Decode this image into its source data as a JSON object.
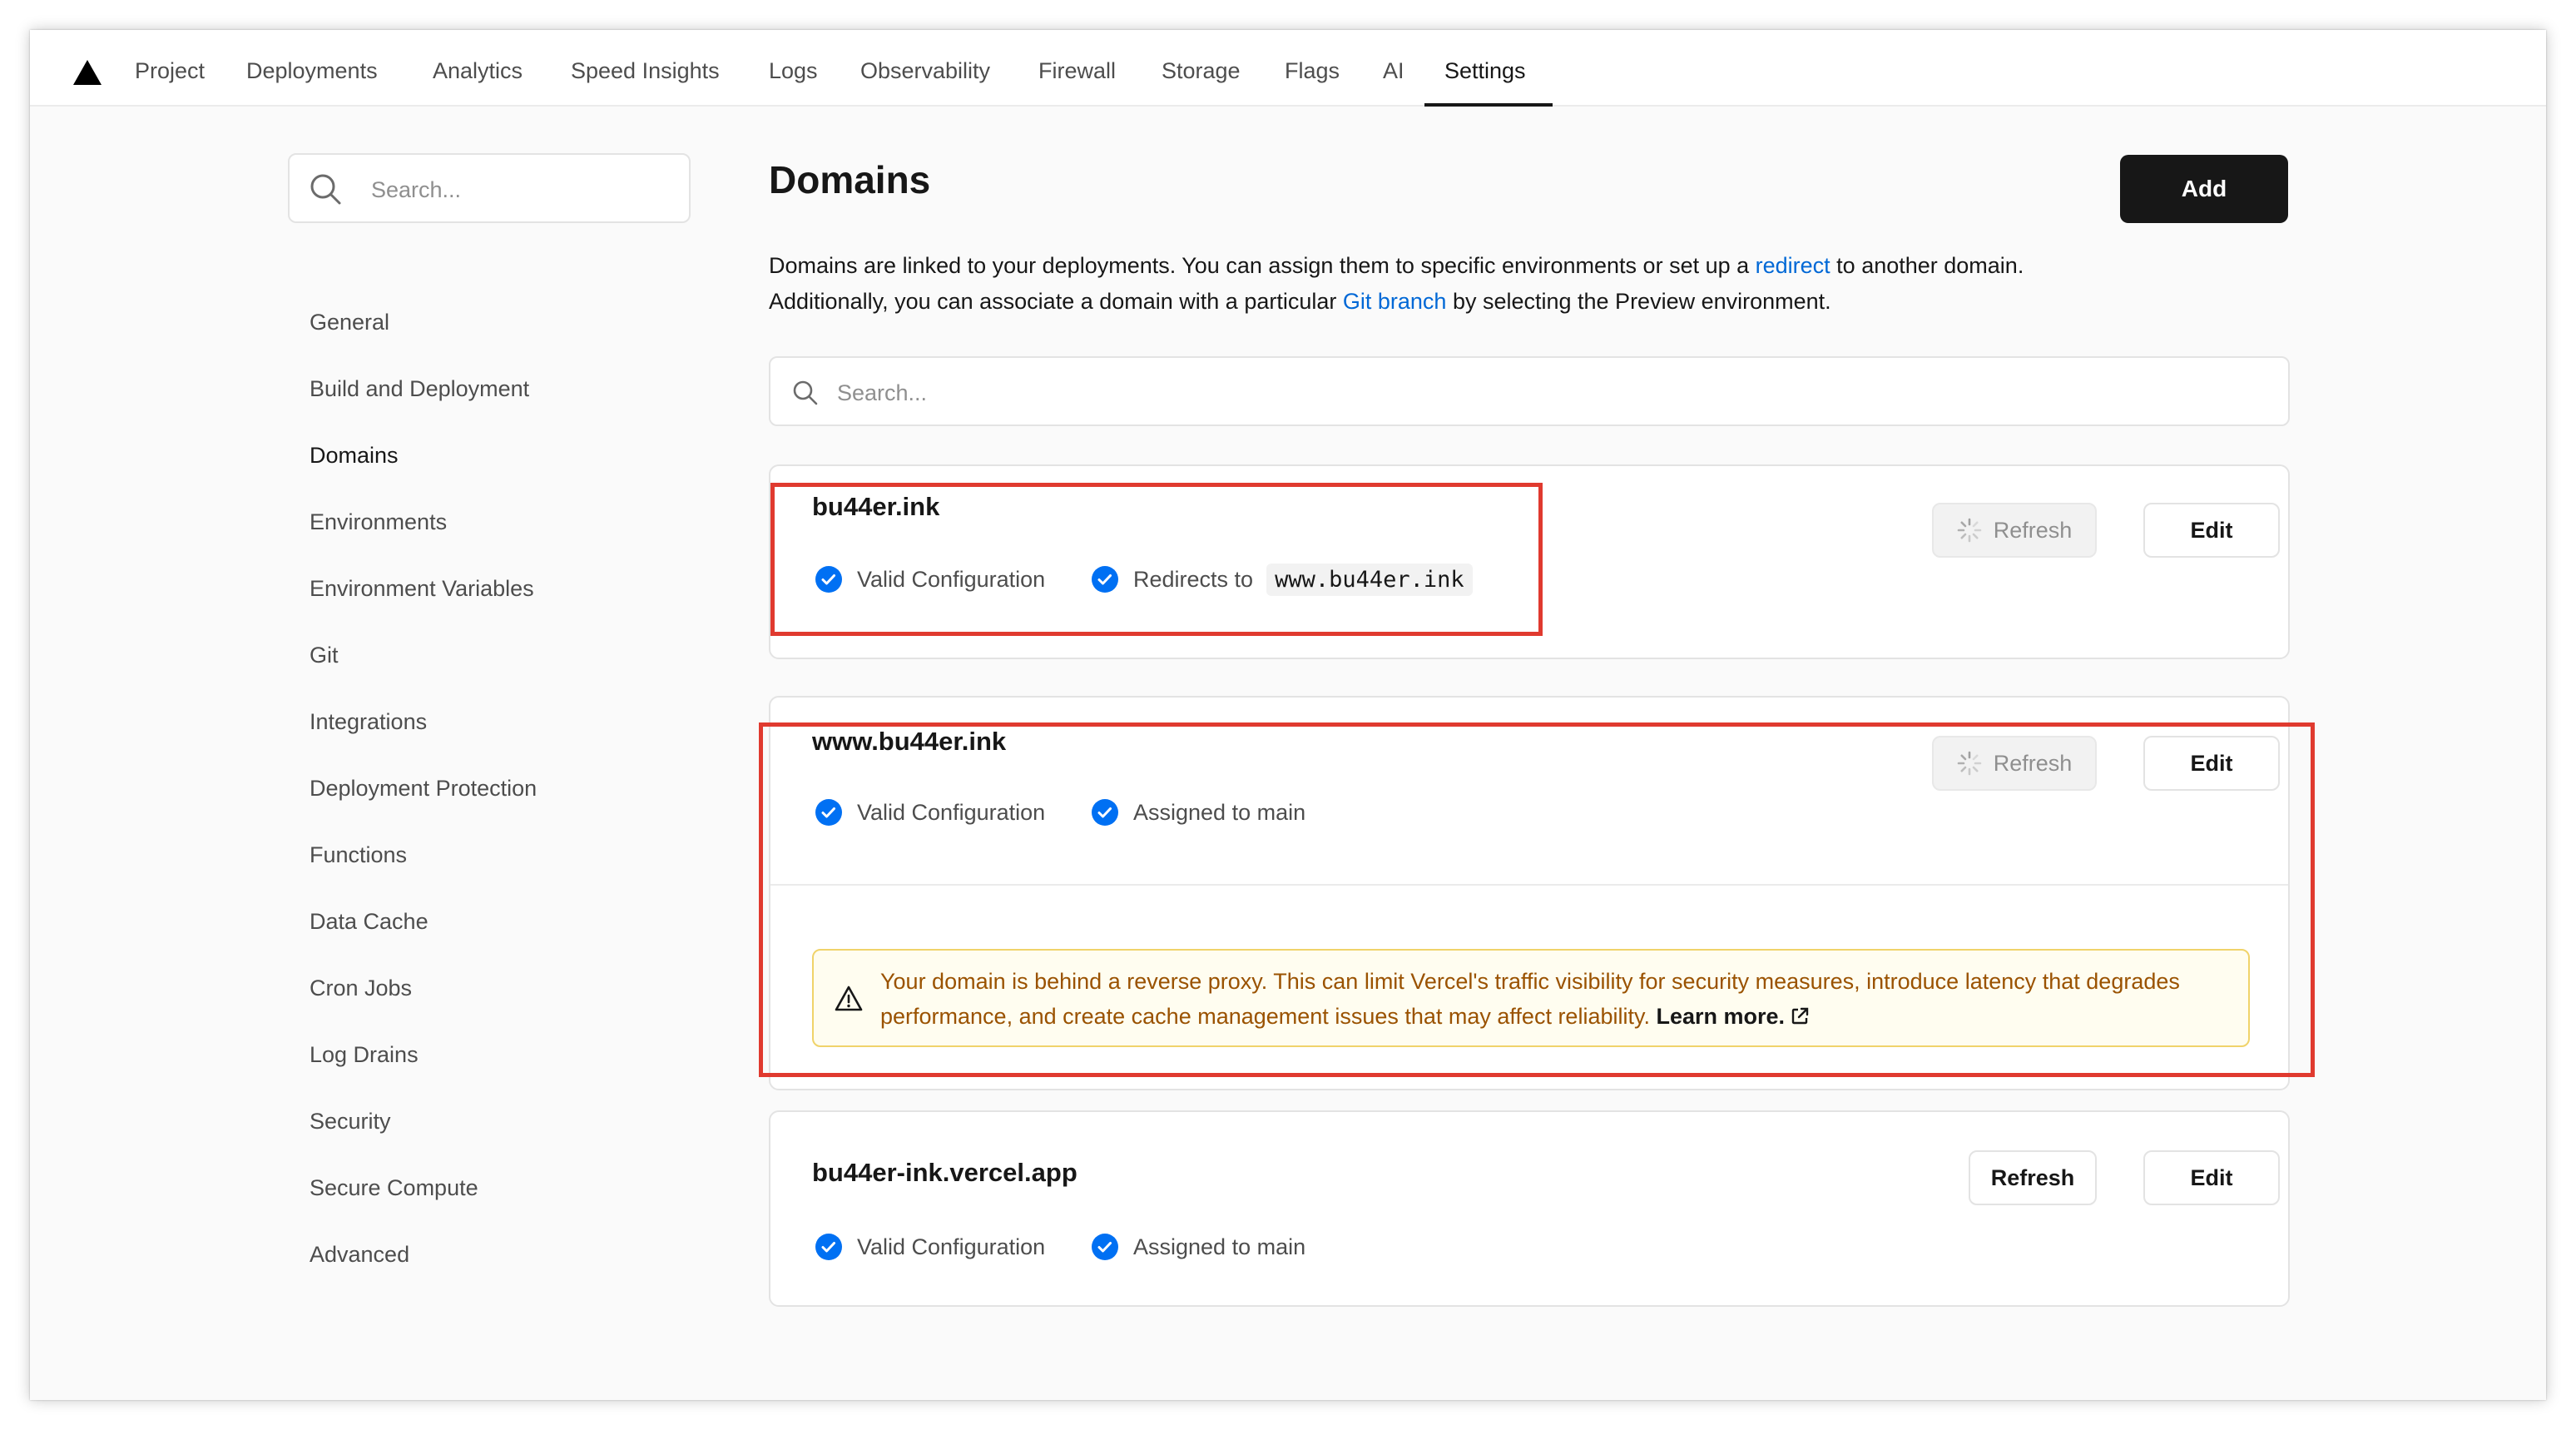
{
  "nav": {
    "logo": "vercel-triangle-icon",
    "items": [
      {
        "label": "Project"
      },
      {
        "label": "Deployments"
      },
      {
        "label": "Analytics"
      },
      {
        "label": "Speed Insights"
      },
      {
        "label": "Logs"
      },
      {
        "label": "Observability"
      },
      {
        "label": "Firewall"
      },
      {
        "label": "Storage"
      },
      {
        "label": "Flags"
      },
      {
        "label": "AI"
      },
      {
        "label": "Settings"
      }
    ],
    "active": "Settings"
  },
  "sidebar": {
    "search_placeholder": "Search...",
    "items": [
      {
        "label": "General"
      },
      {
        "label": "Build and Deployment"
      },
      {
        "label": "Domains"
      },
      {
        "label": "Environments"
      },
      {
        "label": "Environment Variables"
      },
      {
        "label": "Git"
      },
      {
        "label": "Integrations"
      },
      {
        "label": "Deployment Protection"
      },
      {
        "label": "Functions"
      },
      {
        "label": "Data Cache"
      },
      {
        "label": "Cron Jobs"
      },
      {
        "label": "Log Drains"
      },
      {
        "label": "Security"
      },
      {
        "label": "Secure Compute"
      },
      {
        "label": "Advanced"
      }
    ],
    "active": "Domains"
  },
  "main": {
    "title": "Domains",
    "add_label": "Add",
    "description": {
      "part1": "Domains are linked to your deployments. You can assign them to specific environments or set up a ",
      "link1": "redirect",
      "part2": " to another domain.",
      "part3": "Additionally, you can associate a domain with a particular ",
      "link2": "Git branch",
      "part4": " by selecting the Preview environment."
    },
    "search_placeholder": "Search...",
    "domains": [
      {
        "name": "bu44er.ink",
        "status1": "Valid Configuration",
        "status2_label": "Redirects to",
        "status2_value": "www.bu44er.ink",
        "refresh_label": "Refresh",
        "edit_label": "Edit"
      },
      {
        "name": "www.bu44er.ink",
        "status1": "Valid Configuration",
        "status2_label": "Assigned to main",
        "refresh_label": "Refresh",
        "edit_label": "Edit",
        "warning_text": "Your domain is behind a reverse proxy. This can limit Vercel's traffic visibility for security measures, introduce latency that degrades performance, and create cache management issues that may affect reliability.",
        "warning_link": "Learn more."
      },
      {
        "name": "bu44er-ink.vercel.app",
        "status1": "Valid Configuration",
        "status2_label": "Assigned to main",
        "refresh_label": "Refresh",
        "edit_label": "Edit"
      }
    ]
  },
  "colors": {
    "accent_blue": "#0068d6",
    "check_blue": "#0070f3",
    "warning_text": "#9a5200",
    "warning_border": "#f0d36a",
    "highlight_red": "#e03a2f",
    "primary_button": "#171717"
  }
}
